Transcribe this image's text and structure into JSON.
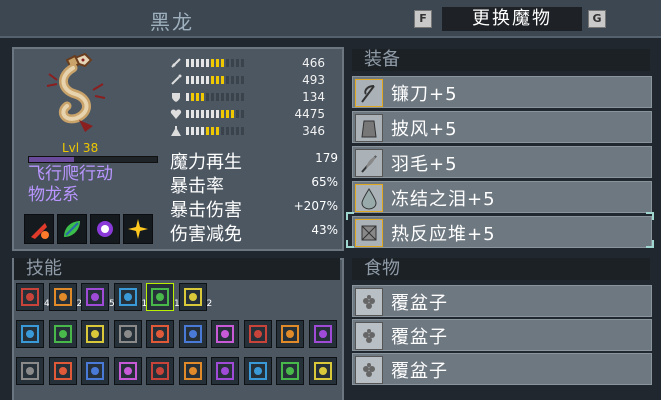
{
  "header": {
    "title": "黑龙",
    "prev_key": "F",
    "next_key": "G",
    "swap_label": "更换魔物"
  },
  "monster": {
    "level": "Lvl 38",
    "xp_fraction": 0.35,
    "species_line1": "飞行爬行动",
    "species_line2": "物龙系"
  },
  "stats": [
    {
      "icon": "sword-icon",
      "value": "466",
      "fill": 0.68
    },
    {
      "icon": "wand-icon",
      "value": "493",
      "fill": 0.68
    },
    {
      "icon": "shield-icon",
      "value": "134",
      "fill": 0.35
    },
    {
      "icon": "heart-icon",
      "value": "4475",
      "fill": 0.82
    },
    {
      "icon": "flask-icon",
      "value": "346",
      "fill": 0.58
    }
  ],
  "combat": [
    {
      "label": "魔力再生",
      "value": "179"
    },
    {
      "label": "暴击率",
      "value": "65%"
    },
    {
      "label": "暴击伤害",
      "value": "+207%"
    },
    {
      "label": "伤害减免",
      "value": "43%"
    }
  ],
  "sections": {
    "equipment": "装备",
    "skills": "技能",
    "food": "食物"
  },
  "equipment": [
    {
      "label": "镰刀+5",
      "icon": "scythe-icon"
    },
    {
      "label": "披风+5",
      "icon": "cloak-icon"
    },
    {
      "label": "羽毛+5",
      "icon": "feather-icon"
    },
    {
      "label": "冻结之泪+5",
      "icon": "tear-icon"
    },
    {
      "label": "热反应堆+5",
      "icon": "reactor-icon"
    }
  ],
  "skill_counts": [
    "4",
    "2",
    "5",
    "1",
    "1",
    "2"
  ],
  "food": [
    {
      "label": "覆盆子",
      "icon": "raspberry-icon"
    },
    {
      "label": "覆盆子",
      "icon": "raspberry-icon"
    },
    {
      "label": "覆盆子",
      "icon": "raspberry-icon"
    }
  ],
  "colors": {
    "accent_gold": "#e0a820",
    "species_purple": "#b996ff",
    "level_yellow": "#f0c800",
    "selected_green": "#b9f000"
  }
}
